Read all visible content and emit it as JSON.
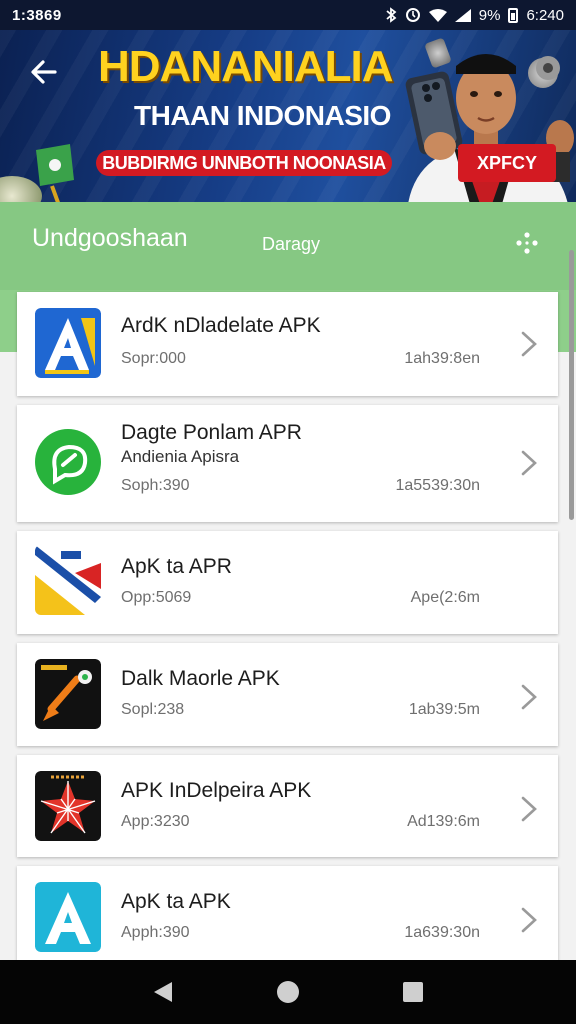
{
  "status_bar": {
    "time": "1:3869",
    "battery_percent": "9%",
    "right_time": "6:240"
  },
  "banner": {
    "title": "HDANANIALIA",
    "subtitle": "THAAN INDONASIO",
    "strip_text": "BUBDIRMG UNNBOTH NOONASIA",
    "badge_text": "XPFCY"
  },
  "header": {
    "title": "Undgooshaan",
    "subtitle": "Daragy"
  },
  "apps": [
    {
      "name": "ArdK nDladelate APK",
      "developer": "",
      "meta": "Sopr:000",
      "size": "1ah39:8en",
      "icon": "a-blue-icon"
    },
    {
      "name": "Dagte Ponlam APR",
      "developer": "Andienia Apisra",
      "meta": "Soph:390",
      "size": "1a5539:30n",
      "icon": "green-chat-icon"
    },
    {
      "name": "ApK ta APR",
      "developer": "",
      "meta": "Opp:5069",
      "size": "Ape(2:6m",
      "icon": "flag-app-icon"
    },
    {
      "name": "Dalk Maorle APK",
      "developer": "",
      "meta": "Sopl:238",
      "size": "1ab39:5m",
      "icon": "tool-app-icon"
    },
    {
      "name": "APK InDelpeira APK",
      "developer": "",
      "meta": "App:3230",
      "size": "Ad139:6m",
      "icon": "red-star-icon"
    },
    {
      "name": "ApK ta APK",
      "developer": "",
      "meta": "Apph:390",
      "size": "1a639:30n",
      "icon": "a-cyan-icon"
    }
  ],
  "colors": {
    "banner_bg": "#163d86",
    "title_yellow": "#ffd21f",
    "accent_red": "#d31a22",
    "header_green": "#8ecf8a"
  }
}
